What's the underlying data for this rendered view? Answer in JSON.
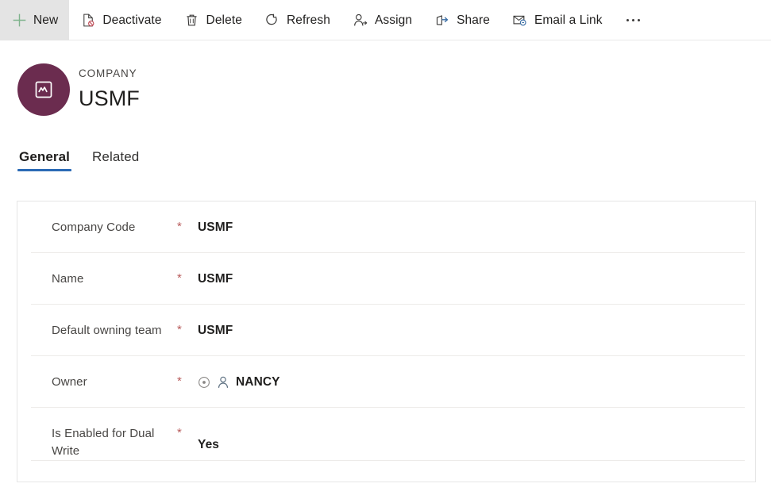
{
  "commandbar": {
    "items": [
      {
        "label": "New",
        "icon": "plus-icon",
        "highlighted": true
      },
      {
        "label": "Deactivate",
        "icon": "deactivate-page-icon",
        "highlighted": false
      },
      {
        "label": "Delete",
        "icon": "trash-icon",
        "highlighted": false
      },
      {
        "label": "Refresh",
        "icon": "refresh-icon",
        "highlighted": false
      },
      {
        "label": "Assign",
        "icon": "assign-person-icon",
        "highlighted": false
      },
      {
        "label": "Share",
        "icon": "share-arrow-icon",
        "highlighted": false
      },
      {
        "label": "Email a Link",
        "icon": "email-link-icon",
        "highlighted": false
      }
    ],
    "overflow_label": "•••",
    "overflow_name": "more-commands-icon"
  },
  "record_header": {
    "eyebrow": "COMPANY",
    "title": "USMF",
    "avatar_icon": "company-entity-icon",
    "avatar_color": "#6b2c4f"
  },
  "tabs": [
    {
      "label": "General",
      "active": true
    },
    {
      "label": "Related",
      "active": false
    }
  ],
  "tab_accent_color": "#2b6ab5",
  "form": {
    "required_marker": "*",
    "rows": [
      {
        "label": "Company Code",
        "required": true,
        "value": "USMF",
        "type": "text"
      },
      {
        "label": "Name",
        "required": true,
        "value": "USMF",
        "type": "text"
      },
      {
        "label": "Default owning team",
        "required": true,
        "value": "USMF",
        "type": "text"
      },
      {
        "label": "Owner",
        "required": true,
        "value": "NANCY",
        "type": "lookup",
        "lookup_icons": [
          "record-status-icon",
          "user-person-icon"
        ]
      },
      {
        "label": "Is Enabled for Dual Write",
        "required": true,
        "value": "Yes",
        "type": "choice"
      }
    ]
  },
  "colors": {
    "accent": "#2b6ab5",
    "required": "#b85c5c",
    "new_icon": "#6eae7f",
    "avatar": "#6b2c4f",
    "share_icon": "#3a6ea5",
    "delete_icon": "#3b3a39"
  }
}
